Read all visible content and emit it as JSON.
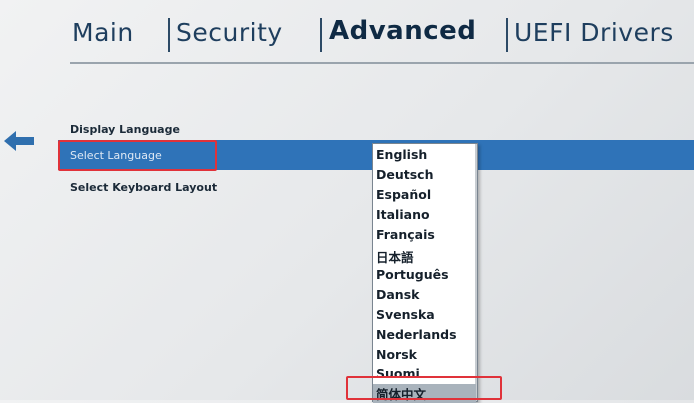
{
  "tabs": {
    "main": "Main",
    "security": "Security",
    "advanced": "Advanced",
    "uefi_drivers": "UEFI Drivers"
  },
  "settings": {
    "display_language": "Display Language",
    "select_language": "Select Language",
    "select_keyboard_layout": "Select Keyboard Layout"
  },
  "language_options": [
    "English",
    "Deutsch",
    "Español",
    "Italiano",
    "Français",
    "日本語",
    "Português",
    "Dansk",
    "Svenska",
    "Nederlands",
    "Norsk",
    "Suomi",
    "简体中文"
  ],
  "colors": {
    "selection_bar": "#2f73b8",
    "highlight_box": "#e0323a",
    "tab_text": "#1e3e5e"
  },
  "icons": {
    "back": "arrow-left-icon"
  }
}
